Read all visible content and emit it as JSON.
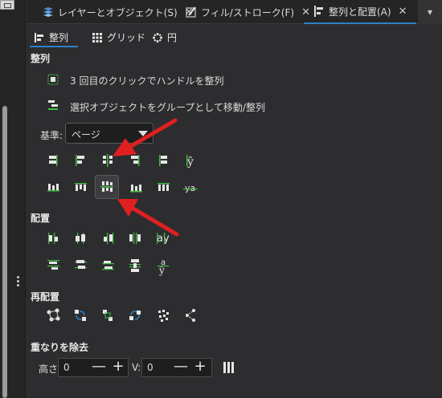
{
  "top_tabs": [
    {
      "label": "レイヤーとオブジェクト(S)",
      "close": "✕"
    },
    {
      "label": "フィル/ストローク(F)",
      "close": "✕"
    },
    {
      "label": "整列と配置(A)",
      "close": "✕"
    }
  ],
  "tab_overflow": "▾",
  "sub_tabs": [
    "整列",
    "グリッド",
    "円"
  ],
  "align": {
    "section": "整列",
    "option1": "3 回目のクリックでハンドルを整列",
    "option2": "選択オブジェクトをグループとして移動/整列",
    "relative_label": "基準:",
    "relative_value": "ページ"
  },
  "distribute_section": "配置",
  "rearrange_section": "再配置",
  "remove_overlap": {
    "section": "重なりを除去",
    "h_label": "高さ:",
    "h_value": "0",
    "v_label": "V:",
    "v_value": "0",
    "minus": "—",
    "plus": "+"
  },
  "colors": {
    "accent": "#2f80c8",
    "arrow": "#e02020",
    "icon_green": "#3fbf3f"
  }
}
